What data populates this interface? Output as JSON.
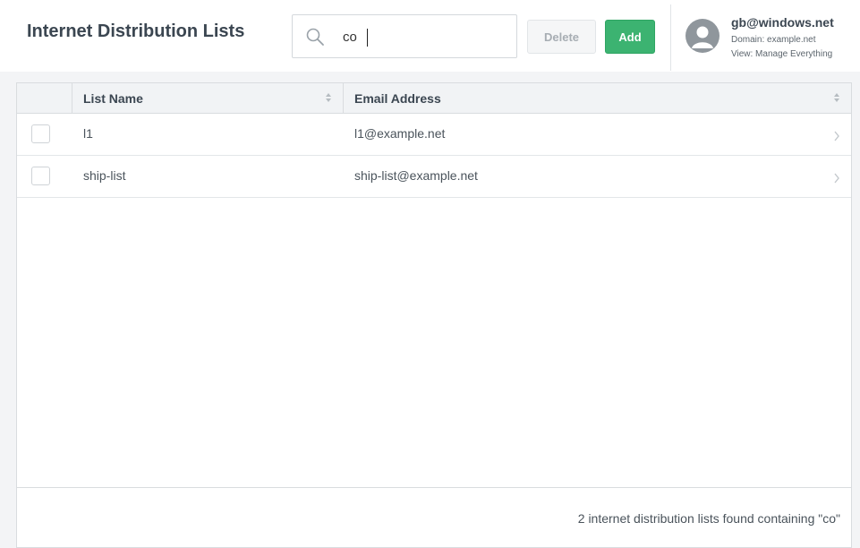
{
  "header": {
    "title": "Internet Distribution Lists",
    "search": {
      "value": "co",
      "placeholder": ""
    },
    "delete_label": "Delete",
    "add_label": "Add",
    "delete_enabled": false
  },
  "user": {
    "name": "gb@windows.net",
    "domain": "Domain: example.net",
    "view": "View: Manage Everything"
  },
  "table": {
    "columns": [
      "List Name",
      "Email Address"
    ],
    "rows": [
      {
        "name": "l1",
        "email": "l1@example.net",
        "checked": false
      },
      {
        "name": "ship-list",
        "email": "ship-list@example.net",
        "checked": false
      }
    ],
    "footer": "2 internet distribution lists found containing \"co\""
  },
  "colors": {
    "accent_green": "#3cb371",
    "title_text": "#3b4651",
    "panel_bg": "#f3f4f6"
  },
  "icons": {
    "search": "search-icon",
    "sort": "sort-icon",
    "row_chevron": "chevron-right-icon",
    "avatar": "user-avatar-icon"
  }
}
